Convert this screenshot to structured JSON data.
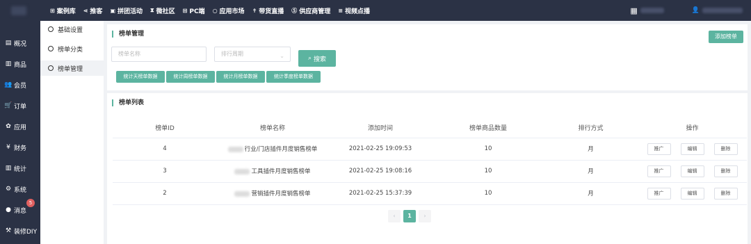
{
  "topnav": {
    "items": [
      {
        "icon": "plus-square-icon",
        "glyph": "⊞",
        "label": "案例库"
      },
      {
        "icon": "share-icon",
        "glyph": "⋖",
        "label": "推客"
      },
      {
        "icon": "image-icon",
        "glyph": "▣",
        "label": "拼团活动"
      },
      {
        "icon": "hourglass-icon",
        "glyph": "⧗",
        "label": "微社区"
      },
      {
        "icon": "plus-square-icon",
        "glyph": "⊞",
        "label": "PC端"
      },
      {
        "icon": "circle-icon",
        "glyph": "○",
        "label": "应用市场"
      },
      {
        "icon": "sparkle-icon",
        "glyph": "✝",
        "label": "带货直播"
      },
      {
        "icon": "skype-icon",
        "glyph": "Ⓢ",
        "label": "供应商管理"
      },
      {
        "icon": "list-icon",
        "glyph": "≡",
        "label": "视频点播"
      }
    ]
  },
  "sidebar": {
    "items": [
      {
        "icon": "archive-icon",
        "glyph": "▤",
        "label": "概况"
      },
      {
        "icon": "product-icon",
        "glyph": "▥",
        "label": "商品"
      },
      {
        "icon": "users-icon",
        "glyph": "👥",
        "label": "会员"
      },
      {
        "icon": "cart-icon",
        "glyph": "🛒",
        "label": "订单"
      },
      {
        "icon": "apps-icon",
        "glyph": "✿",
        "label": "应用"
      },
      {
        "icon": "yen-icon",
        "glyph": "¥",
        "label": "财务"
      },
      {
        "icon": "chart-icon",
        "glyph": "▥",
        "label": "统计"
      },
      {
        "icon": "gears-icon",
        "glyph": "⚙",
        "label": "系统"
      },
      {
        "icon": "message-icon",
        "glyph": "●",
        "label": "消息"
      },
      {
        "icon": "brush-icon",
        "glyph": "⚒",
        "label": "装修DIY"
      }
    ],
    "message_badge": "5"
  },
  "subnav": {
    "items": [
      "基础设置",
      "榜单分类",
      "榜单管理"
    ]
  },
  "manage_panel": {
    "title": "榜单管理",
    "add_button": "添加榜单",
    "name_placeholder": "榜单名称",
    "period_placeholder": "排行周期",
    "search_button": "搜索",
    "stat_buttons": [
      "统计天榜单数据",
      "统计周榜单数据",
      "统计月榜单数据",
      "统计季度榜单数据"
    ]
  },
  "list_panel": {
    "title": "榜单列表",
    "columns": [
      "榜单ID",
      "榜单名称",
      "添加时间",
      "榜单商品数量",
      "排行方式",
      "操作"
    ],
    "rows": [
      {
        "id": "4",
        "name": "行业/门店插件月度销售榜单",
        "time": "2021-02-25 19:09:53",
        "count": "10",
        "mode": "月"
      },
      {
        "id": "3",
        "name": "工具插件月度销售榜单",
        "time": "2021-02-25 19:08:16",
        "count": "10",
        "mode": "月"
      },
      {
        "id": "2",
        "name": "营销插件月度销售榜单",
        "time": "2021-02-25 15:37:39",
        "count": "10",
        "mode": "月"
      }
    ],
    "row_actions": [
      "推广",
      "编辑",
      "删除"
    ],
    "pager": {
      "prev": "‹",
      "current": "1",
      "next": "›"
    }
  },
  "colors": {
    "accent": "#5cb4a0",
    "nav_bg": "#2b3245",
    "page_bg": "#f0f2f5"
  }
}
